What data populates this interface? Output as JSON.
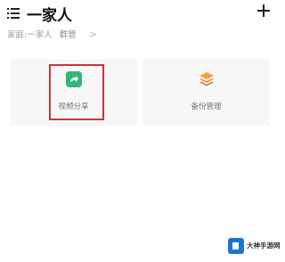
{
  "header": {
    "title": "一家人",
    "menu_icon": "list-menu-icon",
    "add_icon": "plus-icon"
  },
  "family": {
    "label": "家庭:一家人",
    "role": "群管",
    "chevron": ">"
  },
  "cards": [
    {
      "label": "视频分享",
      "icon": "share-arrow-icon",
      "icon_color": "#2fb87a",
      "highlighted": true
    },
    {
      "label": "备份管理",
      "icon": "layers-icon",
      "icon_color": "#f08a2c",
      "highlighted": false
    }
  ],
  "colors": {
    "highlight": "#c8353a",
    "card_bg": "#f7f7f7"
  }
}
